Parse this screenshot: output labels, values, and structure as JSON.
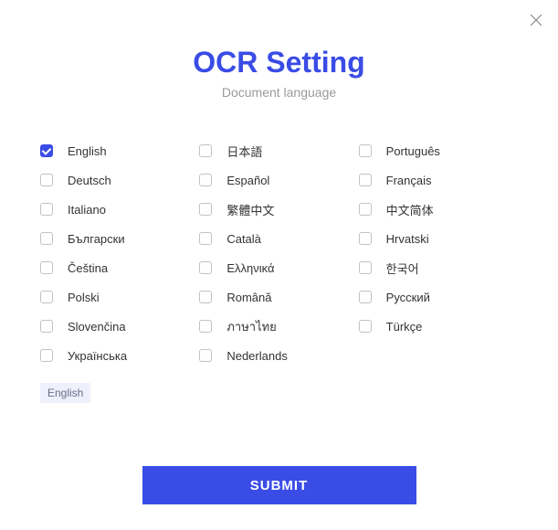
{
  "title": "OCR Setting",
  "subtitle": "Document language",
  "columns": [
    [
      {
        "label": "English",
        "checked": true
      },
      {
        "label": "Deutsch",
        "checked": false
      },
      {
        "label": "Italiano",
        "checked": false
      },
      {
        "label": "Български",
        "checked": false
      },
      {
        "label": "Čeština",
        "checked": false
      },
      {
        "label": "Polski",
        "checked": false
      },
      {
        "label": "Slovenčina",
        "checked": false
      },
      {
        "label": "Українська",
        "checked": false
      }
    ],
    [
      {
        "label": "日本語",
        "checked": false
      },
      {
        "label": "Español",
        "checked": false
      },
      {
        "label": "繁體中文",
        "checked": false
      },
      {
        "label": "Català",
        "checked": false
      },
      {
        "label": "Ελληνικά",
        "checked": false
      },
      {
        "label": "Română",
        "checked": false
      },
      {
        "label": "ภาษาไทย",
        "checked": false
      },
      {
        "label": "Nederlands",
        "checked": false
      }
    ],
    [
      {
        "label": "Português",
        "checked": false
      },
      {
        "label": "Français",
        "checked": false
      },
      {
        "label": "中文简体",
        "checked": false
      },
      {
        "label": "Hrvatski",
        "checked": false
      },
      {
        "label": "한국어",
        "checked": false
      },
      {
        "label": "Русский",
        "checked": false
      },
      {
        "label": "Türkçe",
        "checked": false
      }
    ]
  ],
  "selected_tag": "English",
  "submit_label": "SUBMIT"
}
